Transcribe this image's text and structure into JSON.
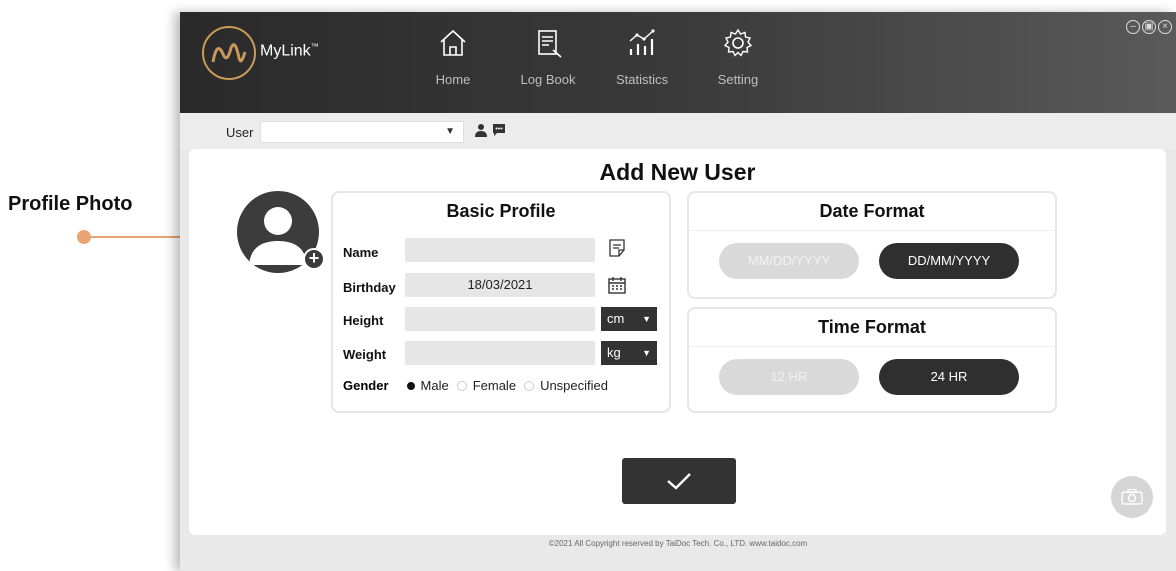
{
  "callout": {
    "label": "Profile Photo"
  },
  "app": {
    "brand": "MyLink",
    "brand_mark": "™",
    "nav": [
      {
        "label": "Home",
        "icon": "home-icon"
      },
      {
        "label": "Log Book",
        "icon": "logbook-icon"
      },
      {
        "label": "Statistics",
        "icon": "statistics-icon"
      },
      {
        "label": "Setting",
        "icon": "gear-icon"
      }
    ],
    "window_controls": [
      "minimize-icon",
      "restore-icon",
      "close-icon"
    ]
  },
  "userbar": {
    "label": "User",
    "selected": ""
  },
  "form": {
    "title": "Add New User",
    "basic_profile": {
      "title": "Basic Profile",
      "name_label": "Name",
      "name_value": "",
      "birthday_label": "Birthday",
      "birthday_value": "18/03/2021",
      "height_label": "Height",
      "height_value": "",
      "height_unit": "cm",
      "weight_label": "Weight",
      "weight_value": "",
      "weight_unit": "kg",
      "gender_label": "Gender",
      "gender_options": [
        "Male",
        "Female",
        "Unspecified"
      ],
      "gender_selected": "Male"
    },
    "date_format": {
      "title": "Date Format",
      "options": [
        "MM/DD/YYYY",
        "DD/MM/YYYY"
      ],
      "selected": "DD/MM/YYYY"
    },
    "time_format": {
      "title": "Time Format",
      "options": [
        "12 HR",
        "24 HR"
      ],
      "selected": "24 HR"
    }
  },
  "footer": {
    "text": "©2021 All Copyright reserved by TaiDoc Tech. Co., LTD.      www.taidoc.com"
  },
  "colors": {
    "accent": "#e8a472",
    "brand_gold": "#c99a5b",
    "dark": "#2f2f2f"
  }
}
